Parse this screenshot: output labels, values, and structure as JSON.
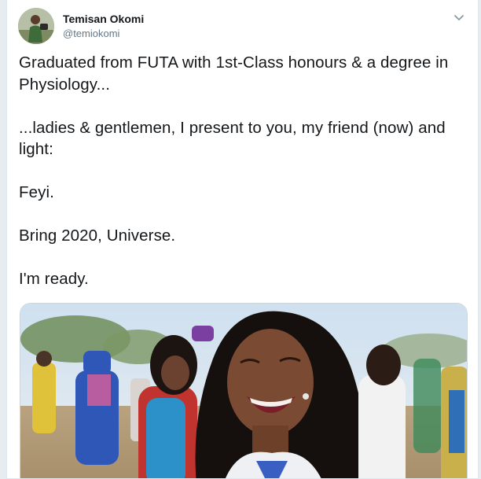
{
  "tweet": {
    "author": {
      "display_name": "Temisan Okomi",
      "handle": "@temiokomi"
    },
    "text": "Graduated from FUTA with 1st-Class honours & a degree in Physiology...\n\n...ladies & gentlemen, I present to you, my friend (now) and light:\n\nFeyi.\n\nBring 2020, Universe.\n\nI'm ready.",
    "icons": {
      "more": "chevron-down-icon"
    },
    "colors": {
      "name": "#14171a",
      "secondary": "#657786",
      "border": "#e1e8ed",
      "background": "#e6ecf0"
    }
  }
}
